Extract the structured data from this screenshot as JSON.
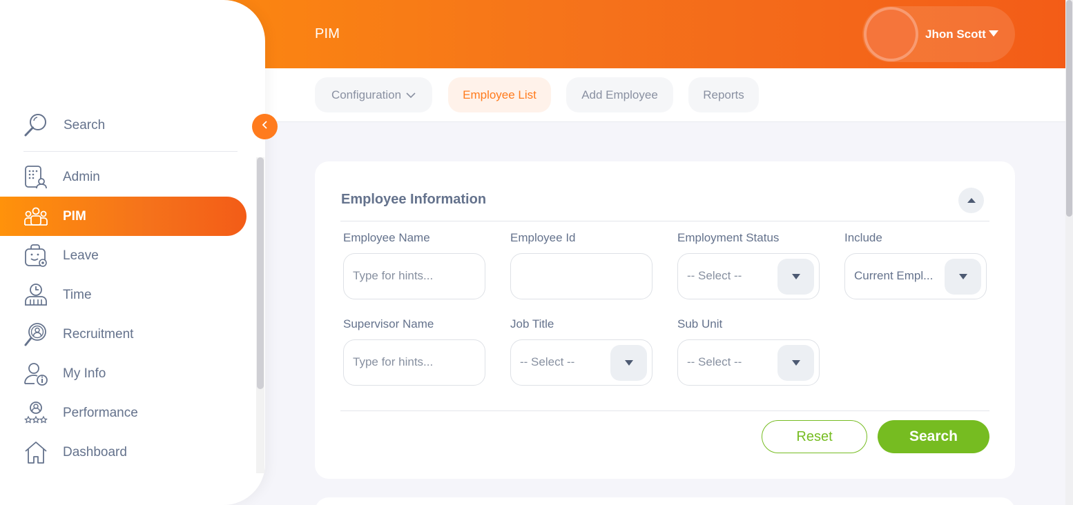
{
  "header": {
    "page_title": "PIM",
    "user_name": "Jhon Scott"
  },
  "subnav": {
    "tabs": [
      {
        "label": "Configuration",
        "active": false,
        "has_dropdown": true
      },
      {
        "label": "Employee List",
        "active": true,
        "has_dropdown": false
      },
      {
        "label": "Add Employee",
        "active": false,
        "has_dropdown": false
      },
      {
        "label": "Reports",
        "active": false,
        "has_dropdown": false
      }
    ]
  },
  "sidebar": {
    "search_label": "Search",
    "items": [
      {
        "label": "Admin",
        "icon": "admin-icon",
        "active": false
      },
      {
        "label": "PIM",
        "icon": "pim-icon",
        "active": true
      },
      {
        "label": "Leave",
        "icon": "leave-icon",
        "active": false
      },
      {
        "label": "Time",
        "icon": "time-icon",
        "active": false
      },
      {
        "label": "Recruitment",
        "icon": "recruitment-icon",
        "active": false
      },
      {
        "label": "My Info",
        "icon": "my-info-icon",
        "active": false
      },
      {
        "label": "Performance",
        "icon": "performance-icon",
        "active": false
      },
      {
        "label": "Dashboard",
        "icon": "dashboard-icon",
        "active": false
      }
    ]
  },
  "form": {
    "title": "Employee Information",
    "fields": {
      "employee_name": {
        "label": "Employee Name",
        "placeholder": "Type for hints..."
      },
      "employee_id": {
        "label": "Employee Id",
        "value": ""
      },
      "employment_status": {
        "label": "Employment Status",
        "value": "-- Select --"
      },
      "include": {
        "label": "Include",
        "value": "Current Empl..."
      },
      "supervisor_name": {
        "label": "Supervisor Name",
        "placeholder": "Type for hints..."
      },
      "job_title": {
        "label": "Job Title",
        "value": "-- Select --"
      },
      "sub_unit": {
        "label": "Sub Unit",
        "value": "-- Select --"
      }
    },
    "reset_label": "Reset",
    "search_label": "Search"
  },
  "colors": {
    "brand_orange": "#ff7b1d",
    "accent_green": "#76bc21",
    "text_muted": "#64728c"
  }
}
